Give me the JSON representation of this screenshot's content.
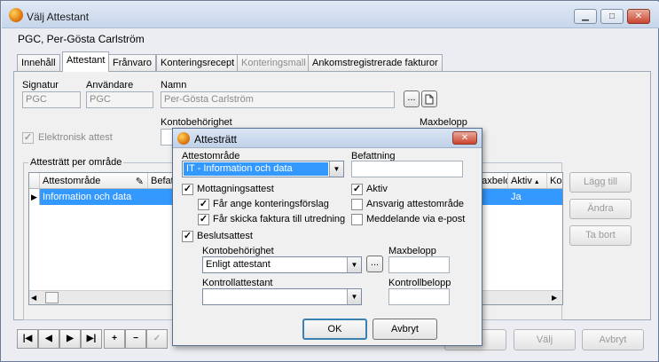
{
  "window": {
    "title": "Välj Attestant",
    "person": "PGC, Per-Gösta Carlström",
    "buttons": {
      "minimize": "▁",
      "maximize": "□",
      "close": "✕"
    }
  },
  "tabs": [
    {
      "label": "Innehåll"
    },
    {
      "label": "Attestant"
    },
    {
      "label": "Frånvaro"
    },
    {
      "label": "Konteringsrecept"
    },
    {
      "label": "Konteringsmall"
    },
    {
      "label": "Ankomstregistrerade fakturor"
    }
  ],
  "form": {
    "signatur_label": "Signatur",
    "signatur_value": "PGC",
    "anvandare_label": "Användare",
    "anvandare_value": "PGC",
    "namn_label": "Namn",
    "namn_value": "Per-Gösta Carlström",
    "kontobehorighet_label": "Kontobehörighet",
    "maxbelopp_label": "Maxbelopp",
    "elektronisk_attest_label": "Elektronisk attest",
    "ellipsis_label": "..."
  },
  "attestratt_group": {
    "label": "Attesträtt per område",
    "columns": [
      "Attestområde",
      "Befattning",
      "Maxbelopp",
      "Aktiv",
      "Ko"
    ],
    "rows": [
      {
        "attestomrade": "Information och data",
        "aktiv": "Ja"
      }
    ],
    "buttons": {
      "add": "Lägg till",
      "edit": "Ändra",
      "remove": "Ta bort"
    }
  },
  "nav_buttons": [
    "|◀",
    "◀",
    "▶",
    "▶|",
    "+",
    "−",
    "✓"
  ],
  "bottom_buttons": {
    "valj": "Välj",
    "avbryt": "Avbryt"
  },
  "dialog": {
    "title": "Attesträtt",
    "attestomrade_label": "Attestområde",
    "attestomrade_value": "IT - Information och data",
    "befattning_label": "Befattning",
    "befattning_value": "",
    "mottagningsattest_label": "Mottagningsattest",
    "far_ange_label": "Får ange konteringsförslag",
    "far_skicka_label": "Får skicka faktura till utredning",
    "aktiv_label": "Aktiv",
    "ansvarig_label": "Ansvarig attestområde",
    "meddelande_label": "Meddelande via e-post",
    "beslutsattest_label": "Beslutsattest",
    "kontobehorighet_label": "Kontobehörighet",
    "kontobehorighet_value": "Enligt attestant",
    "maxbelopp_label": "Maxbelopp",
    "kontrollattestant_label": "Kontrollattestant",
    "kontrollbelopp_label": "Kontrollbelopp",
    "ok_label": "OK",
    "avbryt_label": "Avbryt",
    "ellipsis_label": "...",
    "check_mark": "✓",
    "dropdown_arrow": "▼"
  }
}
